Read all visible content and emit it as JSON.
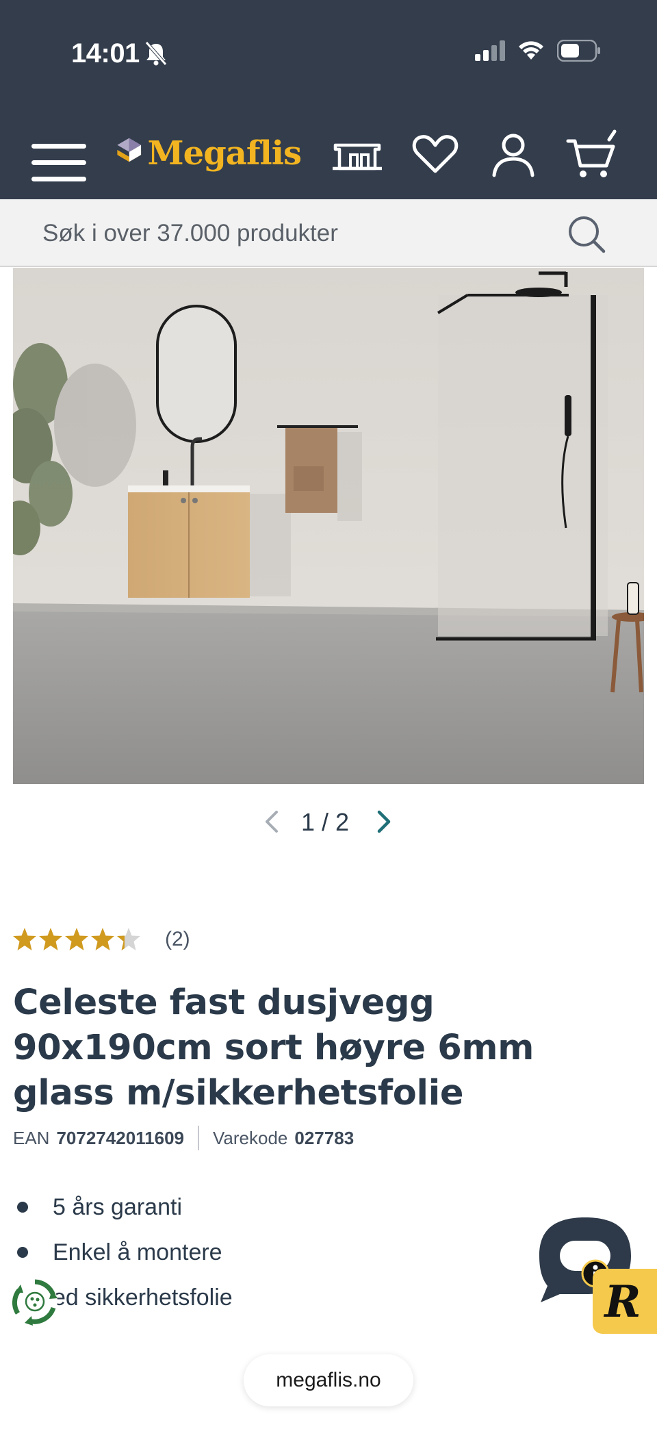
{
  "status_bar": {
    "time": "14:01"
  },
  "header": {
    "logo_text": "Megaflis",
    "icons": [
      "menu-icon",
      "store-icon",
      "heart-icon",
      "user-icon",
      "cart-icon"
    ]
  },
  "search": {
    "placeholder": "Søk i over 37.000 produkter"
  },
  "gallery": {
    "current": "1",
    "separator": "/",
    "total": "2",
    "pager_text": "1 / 2"
  },
  "product": {
    "rating": 4.5,
    "review_count": "(2)",
    "title": "Celeste fast dusjvegg 90x190cm sort høyre 6mm glass m/sikkerhetsfolie",
    "ean_label": "EAN",
    "ean_value": "7072742011609",
    "code_label": "Varekode",
    "code_value": "027783",
    "features": [
      "5 års garanti",
      "Enkel å montere",
      "ed sikkerhetsfolie"
    ]
  },
  "browser": {
    "url": "megaflis.no"
  },
  "colors": {
    "header_bg": "#333d4c",
    "logo": "#f2b420",
    "star": "#d09a1f",
    "accent_teal": "#1f6f78",
    "chat": "#2e3a49",
    "badge": "#f5c94b"
  }
}
